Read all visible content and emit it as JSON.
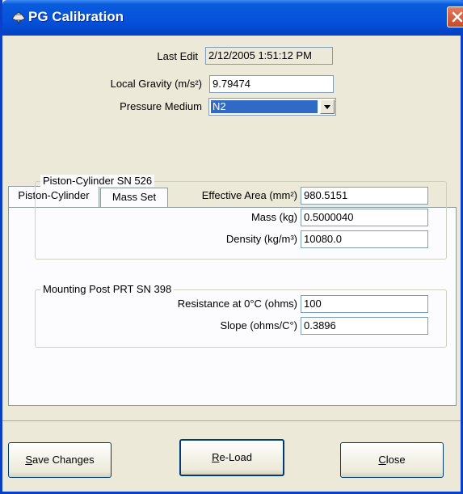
{
  "window": {
    "title": "PG Calibration"
  },
  "header": {
    "last_edit_label": "Last Edit",
    "last_edit_value": "2/12/2005 1:51:12 PM",
    "gravity_label": "Local Gravity (m/s²)",
    "gravity_value": "9.79474",
    "medium_label": "Pressure Medium",
    "medium_value": "N2"
  },
  "tabs": [
    {
      "label": "Piston-Cylinder",
      "active": true
    },
    {
      "label": "Mass Set",
      "active": false
    }
  ],
  "piston_group": {
    "title": "Piston-Cylinder SN 526",
    "fields": [
      {
        "label": "Effective Area (mm²)",
        "value": "980.5151"
      },
      {
        "label": "Mass (kg)",
        "value": "0.5000040"
      },
      {
        "label": "Density (kg/m³)",
        "value": "10080.0"
      }
    ]
  },
  "prt_group": {
    "title": "Mounting Post PRT SN 398",
    "fields": [
      {
        "label": "Resistance at 0°C (ohms)",
        "value": "100"
      },
      {
        "label": "Slope (ohms/C°)",
        "value": "0.3896"
      }
    ]
  },
  "buttons": {
    "save": {
      "mnemonic": "S",
      "rest": "ave Changes"
    },
    "reload": {
      "mnemonic": "R",
      "rest": "e-Load"
    },
    "close": {
      "mnemonic": "C",
      "rest": "lose"
    }
  },
  "colors": {
    "titlebar": "#0551dc",
    "window_bg": "#ece9d8",
    "selection": "#316ac5"
  }
}
